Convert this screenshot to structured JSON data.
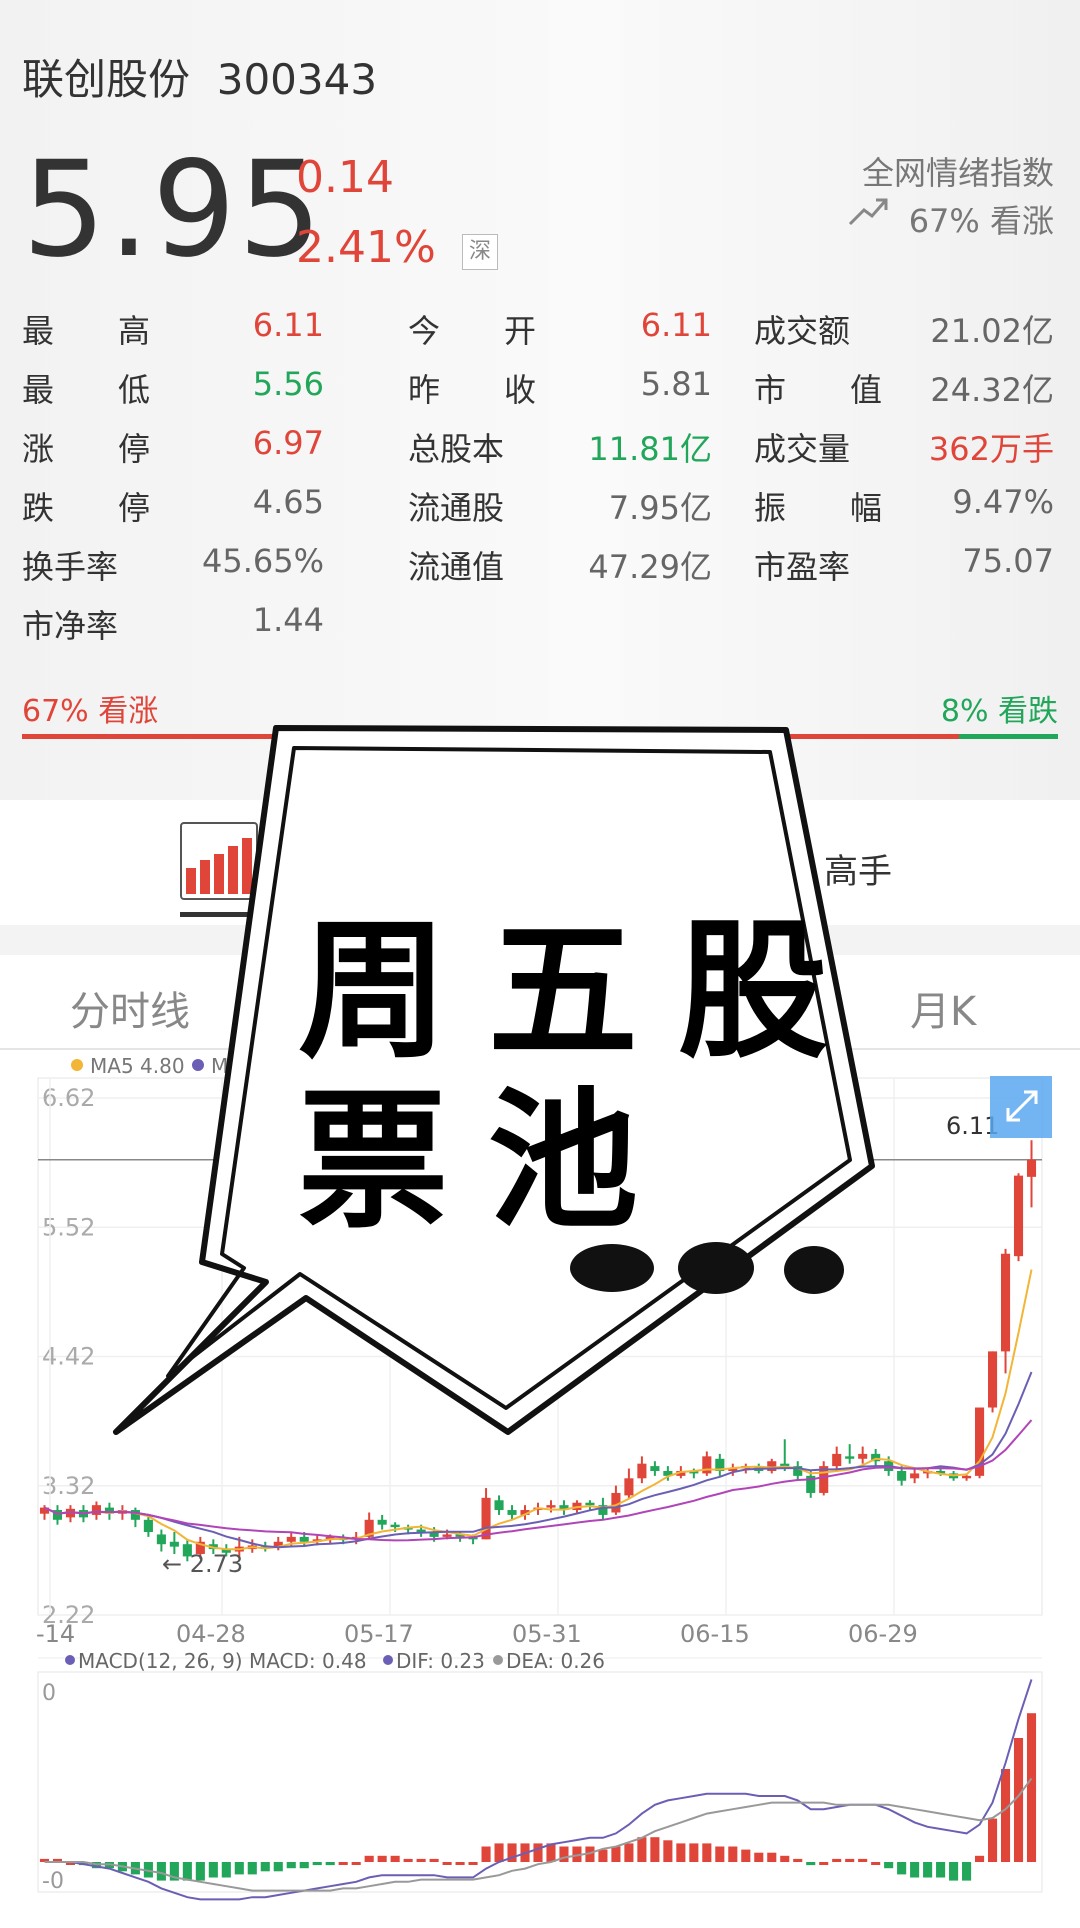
{
  "stock": {
    "name": "联创股份",
    "code": "300343",
    "exchange": "深"
  },
  "quote": {
    "price": "5.95",
    "change": "0.14",
    "change_pct": "2.41%"
  },
  "sentiment": {
    "title": "全网情绪指数",
    "value": "67% 看涨",
    "bull": "67% 看涨",
    "bear": "8% 看跌",
    "bull_fraction": 0.67,
    "bear_fraction": 0.08
  },
  "stats": {
    "col1": [
      {
        "label": "最　　高",
        "value": "6.11",
        "color": "red"
      },
      {
        "label": "最　　低",
        "value": "5.56",
        "color": "green"
      },
      {
        "label": "涨　　停",
        "value": "6.97",
        "color": "red"
      },
      {
        "label": "跌　　停",
        "value": "4.65",
        "color": "gray"
      },
      {
        "label": "换手率",
        "value": "45.65%",
        "color": "gray"
      },
      {
        "label": "市净率",
        "value": "1.44",
        "color": "gray"
      }
    ],
    "col2": [
      {
        "label": "今　　开",
        "value": "6.11",
        "color": "red"
      },
      {
        "label": "昨　　收",
        "value": "5.81",
        "color": "gray"
      },
      {
        "label": "总股本",
        "value": "11.81亿",
        "color": "green"
      },
      {
        "label": "流通股",
        "value": "7.95亿",
        "color": "gray"
      },
      {
        "label": "流通值",
        "value": "47.29亿",
        "color": "gray"
      }
    ],
    "col3": [
      {
        "label": "成交额",
        "value": "21.02亿",
        "color": "gray"
      },
      {
        "label": "市　　值",
        "value": "24.32亿",
        "color": "gray"
      },
      {
        "label": "成交量",
        "value": "362万手",
        "color": "red"
      },
      {
        "label": "振　　幅",
        "value": "9.47%",
        "color": "gray"
      },
      {
        "label": "市盈率",
        "value": "75.07",
        "color": "gray"
      }
    ]
  },
  "toolbar": {
    "expert_label": "高手"
  },
  "period_tabs": {
    "intraday": "分时线",
    "monthly": "月K"
  },
  "overlay": {
    "line1": "周五股",
    "line2": "票池"
  },
  "colors": {
    "up": "#e0453a",
    "down": "#21a65a",
    "ma5": "#f2b535",
    "ma10": "#6a5fb5",
    "ma20": "#b044b8",
    "dif": "#6a5fb5",
    "dea": "#999999"
  },
  "chart_data": [
    {
      "type": "candlestick",
      "legend": [
        {
          "name": "MA5",
          "value": "4.80",
          "color": "#f2b535"
        },
        {
          "name": "M",
          "color": "#6a5fb5"
        }
      ],
      "y_ticks": [
        "6.62",
        "5.52",
        "4.42",
        "3.32",
        "2.22"
      ],
      "x_ticks": [
        "-14",
        "04-28",
        "05-17",
        "05-31",
        "06-15",
        "06-29"
      ],
      "ylim": [
        2.22,
        6.62
      ],
      "annotations": {
        "low_label": "← 2.73",
        "high_label": "6.11",
        "current_line": 5.95
      },
      "candles": [
        [
          3.05,
          3.1,
          3.0,
          3.12
        ],
        [
          3.08,
          3.0,
          2.96,
          3.12
        ],
        [
          3.02,
          3.09,
          2.98,
          3.12
        ],
        [
          3.08,
          3.02,
          2.98,
          3.12
        ],
        [
          3.04,
          3.12,
          3.0,
          3.15
        ],
        [
          3.1,
          3.05,
          3.0,
          3.14
        ],
        [
          3.05,
          3.08,
          3.0,
          3.12
        ],
        [
          3.08,
          3.0,
          2.94,
          3.1
        ],
        [
          3.0,
          2.9,
          2.86,
          3.04
        ],
        [
          2.88,
          2.8,
          2.74,
          2.92
        ],
        [
          2.82,
          2.78,
          2.72,
          2.9
        ],
        [
          2.8,
          2.7,
          2.66,
          2.84
        ],
        [
          2.72,
          2.82,
          2.68,
          2.86
        ],
        [
          2.8,
          2.76,
          2.72,
          2.84
        ],
        [
          2.76,
          2.73,
          2.7,
          2.8
        ],
        [
          2.74,
          2.78,
          2.7,
          2.86
        ],
        [
          2.76,
          2.79,
          2.73,
          2.84
        ],
        [
          2.78,
          2.77,
          2.74,
          2.82
        ],
        [
          2.78,
          2.82,
          2.75,
          2.86
        ],
        [
          2.82,
          2.86,
          2.78,
          2.9
        ],
        [
          2.86,
          2.82,
          2.78,
          2.9
        ],
        [
          2.82,
          2.84,
          2.79,
          2.88
        ],
        [
          2.84,
          2.86,
          2.8,
          2.88
        ],
        [
          2.85,
          2.84,
          2.8,
          2.88
        ],
        [
          2.84,
          2.86,
          2.8,
          2.9
        ],
        [
          2.86,
          3.0,
          2.84,
          3.06
        ],
        [
          3.0,
          2.96,
          2.92,
          3.04
        ],
        [
          2.96,
          2.94,
          2.9,
          2.98
        ],
        [
          2.94,
          2.92,
          2.88,
          2.96
        ],
        [
          2.92,
          2.9,
          2.86,
          2.96
        ],
        [
          2.9,
          2.86,
          2.82,
          2.94
        ],
        [
          2.86,
          2.88,
          2.84,
          2.92
        ],
        [
          2.88,
          2.86,
          2.82,
          2.9
        ],
        [
          2.86,
          2.84,
          2.8,
          2.88
        ],
        [
          2.84,
          3.18,
          2.84,
          3.26
        ],
        [
          3.16,
          3.08,
          3.04,
          3.2
        ],
        [
          3.08,
          3.04,
          3.0,
          3.12
        ],
        [
          3.04,
          3.08,
          3.0,
          3.12
        ],
        [
          3.08,
          3.1,
          3.04,
          3.14
        ],
        [
          3.1,
          3.12,
          3.06,
          3.16
        ],
        [
          3.12,
          3.08,
          3.04,
          3.16
        ],
        [
          3.08,
          3.14,
          3.06,
          3.16
        ],
        [
          3.14,
          3.12,
          3.08,
          3.16
        ],
        [
          3.12,
          3.04,
          3.0,
          3.18
        ],
        [
          3.06,
          3.22,
          3.04,
          3.28
        ],
        [
          3.2,
          3.34,
          3.18,
          3.42
        ],
        [
          3.34,
          3.46,
          3.3,
          3.52
        ],
        [
          3.44,
          3.4,
          3.36,
          3.48
        ],
        [
          3.4,
          3.36,
          3.32,
          3.44
        ],
        [
          3.36,
          3.4,
          3.34,
          3.44
        ],
        [
          3.4,
          3.38,
          3.34,
          3.42
        ],
        [
          3.38,
          3.52,
          3.36,
          3.56
        ],
        [
          3.5,
          3.4,
          3.36,
          3.54
        ],
        [
          3.4,
          3.42,
          3.36,
          3.46
        ],
        [
          3.42,
          3.44,
          3.38,
          3.46
        ],
        [
          3.44,
          3.4,
          3.38,
          3.46
        ],
        [
          3.4,
          3.48,
          3.38,
          3.5
        ],
        [
          3.46,
          3.44,
          3.4,
          3.66
        ],
        [
          3.44,
          3.36,
          3.32,
          3.48
        ],
        [
          3.36,
          3.22,
          3.18,
          3.4
        ],
        [
          3.22,
          3.44,
          3.2,
          3.48
        ],
        [
          3.44,
          3.54,
          3.4,
          3.6
        ],
        [
          3.52,
          3.5,
          3.46,
          3.62
        ],
        [
          3.5,
          3.54,
          3.46,
          3.6
        ],
        [
          3.54,
          3.48,
          3.44,
          3.58
        ],
        [
          3.48,
          3.4,
          3.36,
          3.52
        ],
        [
          3.4,
          3.32,
          3.28,
          3.44
        ],
        [
          3.34,
          3.38,
          3.3,
          3.42
        ],
        [
          3.38,
          3.4,
          3.34,
          3.42
        ],
        [
          3.4,
          3.38,
          3.36,
          3.42
        ],
        [
          3.38,
          3.34,
          3.32,
          3.4
        ],
        [
          3.34,
          3.36,
          3.32,
          3.38
        ],
        [
          3.36,
          3.92,
          3.34,
          3.92
        ],
        [
          3.92,
          4.38,
          3.88,
          4.38
        ],
        [
          4.38,
          5.18,
          4.2,
          5.22
        ],
        [
          5.16,
          5.82,
          5.12,
          5.84
        ],
        [
          5.81,
          5.95,
          5.56,
          6.11
        ]
      ]
    },
    {
      "type": "bar-line",
      "title": "MACD(12, 26, 9)",
      "legend": [
        {
          "name": "MACD",
          "value": "0.48"
        },
        {
          "name": "DIF",
          "value": "0.23"
        },
        {
          "name": "DEA",
          "value": "0.26"
        }
      ],
      "y_ticks": [
        "0",
        "-0"
      ],
      "macd": [
        0.01,
        0.01,
        0.0,
        -0.01,
        -0.02,
        -0.02,
        -0.03,
        -0.04,
        -0.05,
        -0.06,
        -0.06,
        -0.06,
        -0.06,
        -0.05,
        -0.05,
        -0.04,
        -0.04,
        -0.03,
        -0.03,
        -0.02,
        -0.02,
        -0.01,
        -0.01,
        0.0,
        0.0,
        0.02,
        0.02,
        0.02,
        0.01,
        0.01,
        0.01,
        0.0,
        0.0,
        0.0,
        0.05,
        0.06,
        0.06,
        0.06,
        0.06,
        0.06,
        0.05,
        0.05,
        0.05,
        0.04,
        0.05,
        0.06,
        0.08,
        0.08,
        0.07,
        0.06,
        0.06,
        0.06,
        0.05,
        0.05,
        0.04,
        0.03,
        0.03,
        0.02,
        0.01,
        -0.01,
        0.0,
        0.01,
        0.01,
        0.01,
        0.0,
        -0.02,
        -0.04,
        -0.05,
        -0.05,
        -0.05,
        -0.06,
        -0.06,
        0.02,
        0.14,
        0.3,
        0.4,
        0.48
      ],
      "dif": [
        0.0,
        0.0,
        0.0,
        -0.01,
        -0.02,
        -0.03,
        -0.05,
        -0.07,
        -0.09,
        -0.12,
        -0.14,
        -0.16,
        -0.17,
        -0.17,
        -0.17,
        -0.17,
        -0.16,
        -0.16,
        -0.15,
        -0.14,
        -0.13,
        -0.12,
        -0.11,
        -0.1,
        -0.09,
        -0.07,
        -0.06,
        -0.06,
        -0.06,
        -0.06,
        -0.06,
        -0.07,
        -0.07,
        -0.07,
        -0.03,
        0.0,
        0.02,
        0.04,
        0.06,
        0.08,
        0.09,
        0.1,
        0.11,
        0.11,
        0.13,
        0.17,
        0.22,
        0.26,
        0.28,
        0.29,
        0.3,
        0.31,
        0.31,
        0.31,
        0.31,
        0.3,
        0.3,
        0.3,
        0.28,
        0.24,
        0.24,
        0.25,
        0.26,
        0.26,
        0.26,
        0.24,
        0.21,
        0.18,
        0.16,
        0.15,
        0.14,
        0.13,
        0.17,
        0.27,
        0.45,
        0.65,
        0.83
      ],
      "dea": [
        0.0,
        0.0,
        0.0,
        0.0,
        -0.01,
        -0.01,
        -0.02,
        -0.03,
        -0.04,
        -0.05,
        -0.07,
        -0.08,
        -0.09,
        -0.1,
        -0.11,
        -0.12,
        -0.13,
        -0.13,
        -0.13,
        -0.13,
        -0.13,
        -0.13,
        -0.13,
        -0.12,
        -0.12,
        -0.11,
        -0.1,
        -0.09,
        -0.09,
        -0.08,
        -0.08,
        -0.08,
        -0.08,
        -0.08,
        -0.07,
        -0.06,
        -0.04,
        -0.03,
        -0.01,
        0.0,
        0.02,
        0.03,
        0.04,
        0.06,
        0.07,
        0.09,
        0.11,
        0.14,
        0.16,
        0.18,
        0.2,
        0.22,
        0.23,
        0.24,
        0.25,
        0.26,
        0.27,
        0.27,
        0.27,
        0.27,
        0.27,
        0.26,
        0.26,
        0.26,
        0.26,
        0.26,
        0.25,
        0.24,
        0.23,
        0.22,
        0.21,
        0.2,
        0.19,
        0.2,
        0.24,
        0.3,
        0.38
      ]
    }
  ]
}
